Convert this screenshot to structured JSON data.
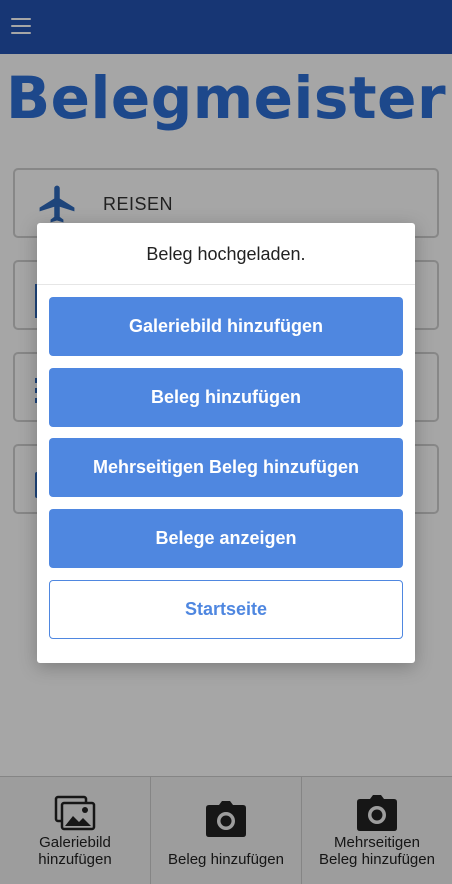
{
  "app": {
    "name": "Belegmeister"
  },
  "header": {
    "menu_icon": "hamburger-menu-icon"
  },
  "menu": {
    "items": [
      {
        "label": "REISEN",
        "icon": "airplane-icon"
      },
      {
        "label": "",
        "icon": ""
      },
      {
        "label": "",
        "icon": ""
      },
      {
        "label": "",
        "icon": ""
      }
    ]
  },
  "dialog": {
    "title": "Beleg hochgeladen.",
    "buttons": [
      {
        "label": "Galeriebild hinzufügen"
      },
      {
        "label": "Beleg hinzufügen"
      },
      {
        "label": "Mehrseitigen Beleg hinzufügen"
      },
      {
        "label": "Belege anzeigen"
      },
      {
        "label": "Startseite"
      }
    ]
  },
  "bottom_nav": {
    "items": [
      {
        "line1": "Galeriebild",
        "line2": "hinzufügen",
        "icon": "gallery-images-icon"
      },
      {
        "line1": "",
        "line2": "Beleg hinzufügen",
        "icon": "camera-icon"
      },
      {
        "line1": "Mehrseitigen",
        "line2": "Beleg hinzufügen",
        "icon": "camera-icon"
      }
    ]
  },
  "colors": {
    "header": "#2453b3",
    "accent": "#4f87e0",
    "logo": "#2d6fd6",
    "icon_blue": "#2f6bbd"
  }
}
